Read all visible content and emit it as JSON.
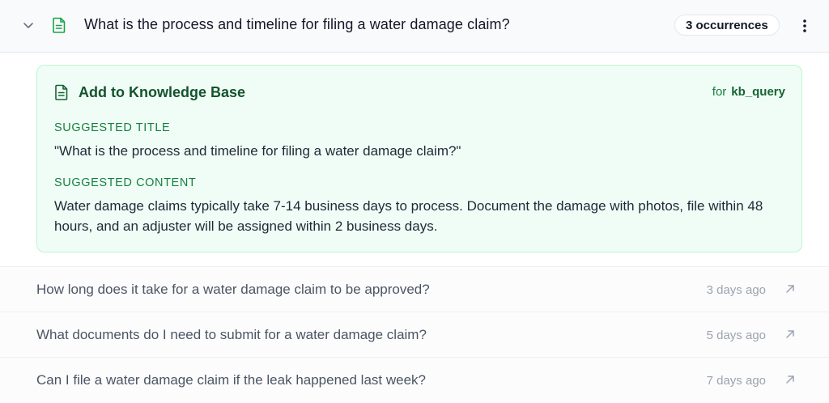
{
  "header": {
    "question": "What is the process and timeline for filing a water damage claim?",
    "occurrences": "3 occurrences"
  },
  "kb_card": {
    "heading": "Add to Knowledge Base",
    "for_label": "for",
    "for_target": "kb_query",
    "title_label": "SUGGESTED TITLE",
    "title_value": "\"What is the process and timeline for filing a water damage claim?\"",
    "content_label": "SUGGESTED CONTENT",
    "content_value": "Water damage claims typically take 7-14 business days to process. Document the damage with photos, file within 48 hours, and an adjuster will be assigned within 2 business days."
  },
  "occurrence_rows": [
    {
      "question": "How long does it take for a water damage claim to be approved?",
      "time": "3 days ago"
    },
    {
      "question": "What documents do I need to submit for a water damage claim?",
      "time": "5 days ago"
    },
    {
      "question": "Can I file a water damage claim if the leak happened last week?",
      "time": "7 days ago"
    }
  ],
  "icons": {
    "collapse": "chevron-down-icon",
    "document": "document-icon",
    "more": "more-vertical-icon",
    "open": "external-link-icon"
  },
  "colors": {
    "accent_green": "#15803d",
    "card_bg": "#f0fdf6",
    "card_border": "#bbf7d0",
    "doc_icon_green": "#16a34a"
  }
}
